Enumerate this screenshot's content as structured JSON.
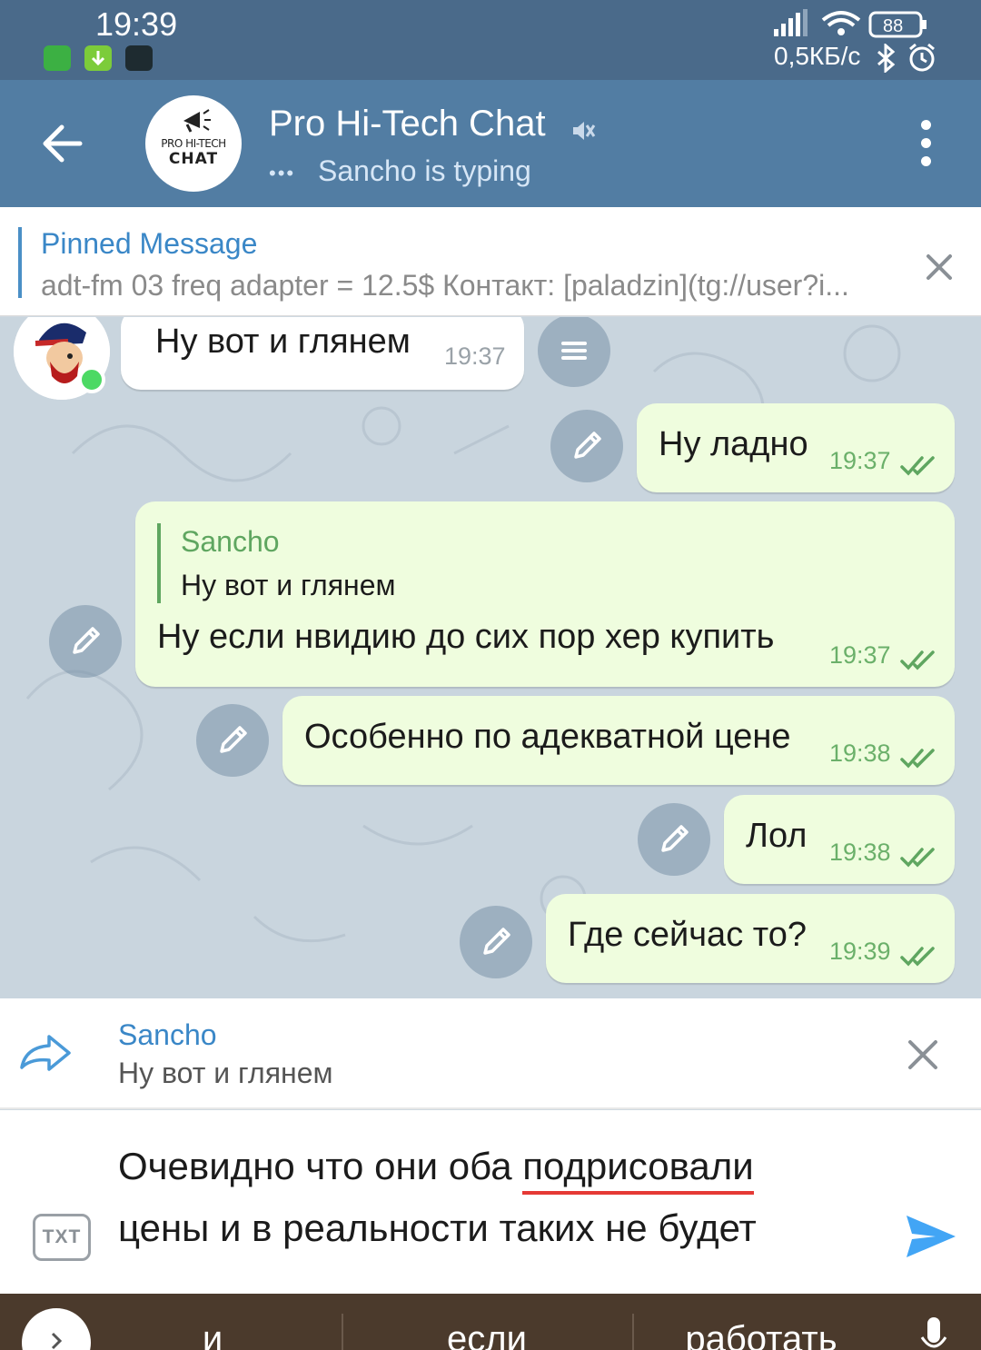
{
  "status_bar": {
    "time": "19:39",
    "speed": "0,5КБ/с",
    "battery": "88"
  },
  "header": {
    "avatar_line1": "PRO HI-TECH",
    "avatar_line2": "CHAT",
    "title": "Pro Hi-Tech Chat",
    "subtitle": "Sancho is typing",
    "typing_dots": "•••"
  },
  "pinned": {
    "title": "Pinned Message",
    "text": "adt-fm 03 freq adapter = 12.5$ Контакт: [paladzin](tg://user?i..."
  },
  "messages": [
    {
      "direction": "in",
      "text": "Ну вот и глянем",
      "time": "19:37"
    },
    {
      "direction": "out",
      "text": "Ну ладно",
      "time": "19:37"
    },
    {
      "direction": "out",
      "reply_name": "Sancho",
      "reply_text": "Ну вот и глянем",
      "text": "Ну если нвидию до сих пор хер купить",
      "time": "19:37"
    },
    {
      "direction": "out",
      "text": "Особенно по адекватной цене",
      "time": "19:38"
    },
    {
      "direction": "out",
      "text": "Лол",
      "time": "19:38"
    },
    {
      "direction": "out",
      "text": "Где сейчас то?",
      "time": "19:39"
    }
  ],
  "reply_panel": {
    "name": "Sancho",
    "text": "Ну вот и глянем"
  },
  "input": {
    "line1_before": "Очевидно что они оба ",
    "line1_misspelled": "подрисовали",
    "line2": "цены и в реальности таких не будет",
    "txt_button": "TXT"
  },
  "keyboard": {
    "suggestions": [
      "и",
      "если",
      "работать"
    ]
  },
  "colors": {
    "header": "#527da3",
    "status_bar": "#4a6a8a",
    "out_bubble": "#effdde",
    "accent_blue": "#3a87c7",
    "time_green": "#6bb06a",
    "send": "#42a5f5"
  }
}
